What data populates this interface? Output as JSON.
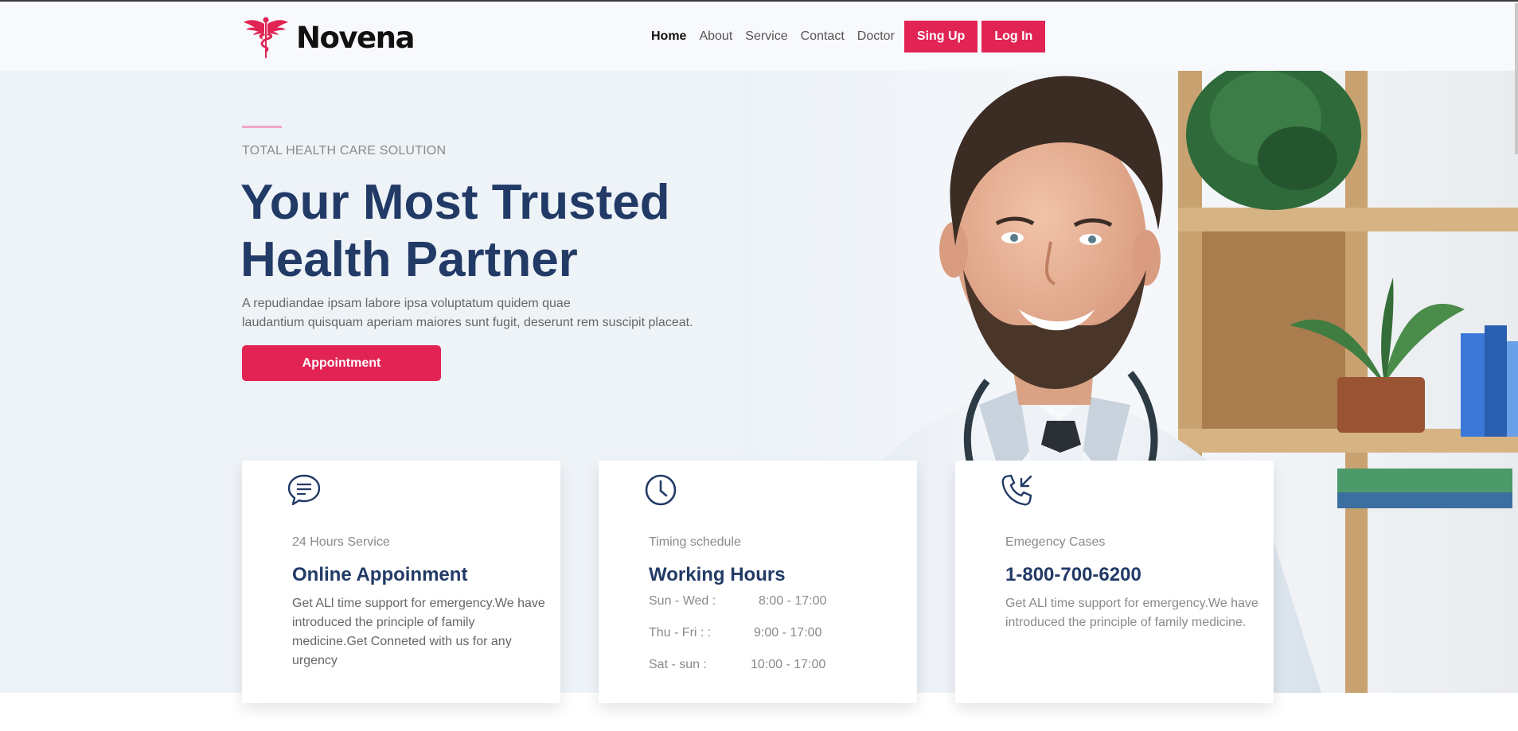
{
  "brand": {
    "name": "Novena",
    "accent": "#e12454",
    "navy": "#223a66"
  },
  "nav": {
    "links": [
      "Home",
      "About",
      "Service",
      "Contact",
      "Doctor"
    ],
    "active": "Home",
    "signup_label": "Sing Up",
    "login_label": "Log In"
  },
  "hero": {
    "eyebrow": "TOTAL HEALTH CARE SOLUTION",
    "title_line1": "Your Most Trusted",
    "title_line2": "Health Partner",
    "desc_line1": "A repudiandae ipsam labore ipsa voluptatum quidem quae",
    "desc_line2": "laudantium quisquam aperiam maiores sunt fugit, deserunt rem suscipit placeat.",
    "cta_label": "Appointment"
  },
  "cards": [
    {
      "icon": "chat-bubble-icon",
      "eyebrow": "24 Hours Service",
      "title": "Online Appoinment",
      "text": "Get ALl time support for emergency.We have introduced the principle of family medicine.Get Conneted with us for any urgency"
    },
    {
      "icon": "clock-icon",
      "eyebrow": "Timing schedule",
      "title": "Working Hours",
      "hours": [
        {
          "day": "Sun - Wed :",
          "time": "8:00 - 17:00"
        },
        {
          "day": "Thu - Fri : :",
          "time": "9:00 - 17:00"
        },
        {
          "day": "Sat - sun :",
          "time": "10:00 - 17:00"
        }
      ]
    },
    {
      "icon": "phone-incoming-icon",
      "eyebrow": "Emegency Cases",
      "title": "1-800-700-6200",
      "text": "Get ALl time support for emergency.We have introduced the principle of family medicine."
    }
  ]
}
